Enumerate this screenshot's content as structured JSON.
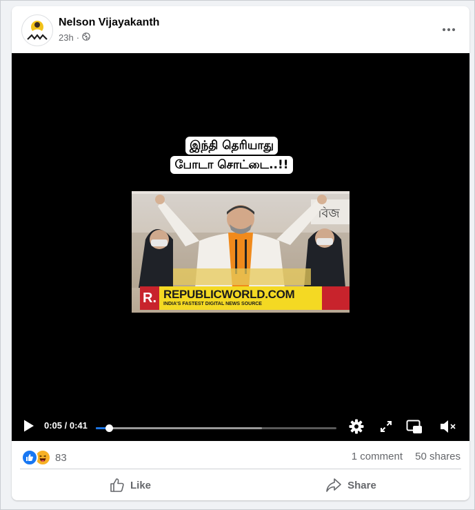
{
  "post": {
    "author": "Nelson Vijayakanth",
    "time": "23h",
    "separator": "·",
    "audience_icon": "globe-icon",
    "more_icon": "more-options-icon"
  },
  "video": {
    "caption_line1": "இந்தி தெரியாது",
    "caption_line2": "போடா சொட்டை..!!",
    "banner_logo_letter": "R.",
    "banner_title": "REPUBLICWORLD.COM",
    "banner_subtitle": "INDIA'S FASTEST DIGITAL NEWS SOURCE",
    "controls": {
      "time": "0:05 / 0:41",
      "progress_fraction": 0.054,
      "buffered_fraction": 0.69,
      "play_icon": "play-icon",
      "settings_icon": "gear-icon",
      "fullscreen_icon": "fullscreen-icon",
      "pip_icon": "picture-in-picture-icon",
      "mute_icon": "volume-muted-icon"
    }
  },
  "stats": {
    "reaction_count": "83",
    "reactions": [
      "like",
      "haha"
    ],
    "comments": "1 comment",
    "shares": "50 shares"
  },
  "actions": {
    "like_label": "Like",
    "share_label": "Share"
  },
  "colors": {
    "brand_blue": "#1877f2",
    "progress_blue": "#1b74e4",
    "secondary_text": "#65676b",
    "banner_yellow": "#f4d923",
    "banner_red": "#c8232c"
  }
}
